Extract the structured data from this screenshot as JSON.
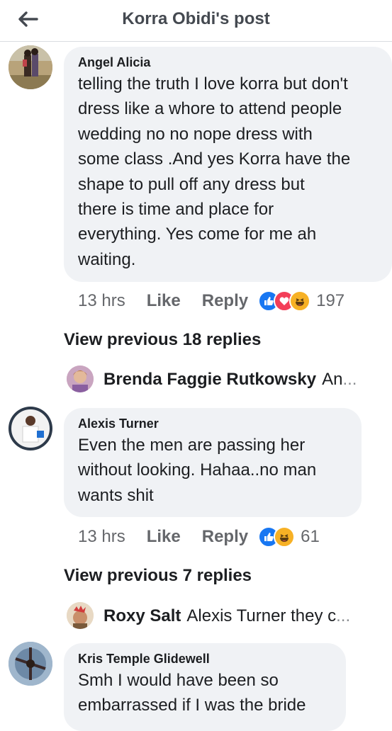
{
  "header": {
    "title": "Korra Obidi's post",
    "back_icon": "arrow-left-icon"
  },
  "comments": [
    {
      "author": "Angel Alicia",
      "lines": [
        "telling the truth I love korra but don't",
        "dress like a whore to attend people",
        "wedding no no nope dress with",
        "some class .And yes Korra have the",
        "shape to pull off any dress  but",
        "there is time and place for",
        "everything. Yes come for me ah",
        "waiting."
      ],
      "time": "13 hrs",
      "like": "Like",
      "reply": "Reply",
      "count": "197",
      "reactions": [
        "like-reaction-icon",
        "love-reaction-icon",
        "haha-reaction-icon"
      ],
      "view_previous": "View previous 18 replies",
      "latest_reply": {
        "name": "Brenda Faggie Rutkowsky",
        "preview": "An",
        "ellipsis": "..."
      }
    },
    {
      "author": "Alexis Turner",
      "lines": [
        "Even the men are passing her",
        "without looking.  Hahaa..no man",
        "wants shit"
      ],
      "time": "13 hrs",
      "like": "Like",
      "reply": "Reply",
      "count": "61",
      "reactions": [
        "like-reaction-icon",
        "haha-reaction-icon"
      ],
      "view_previous": "View previous 7 replies",
      "latest_reply": {
        "name": "Roxy Salt",
        "preview": "Alexis Turner  they c",
        "ellipsis": "..."
      }
    },
    {
      "author": "Kris Temple Glidewell",
      "lines": [
        "Smh I would have been so",
        "embarrassed if I was the bride"
      ]
    }
  ],
  "colors": {
    "like_blue": "#1877f2",
    "love_red": "#f33e58",
    "haha_yellow": "#f7b125",
    "bubble": "#f0f2f5",
    "meta_gray": "#65676b"
  }
}
